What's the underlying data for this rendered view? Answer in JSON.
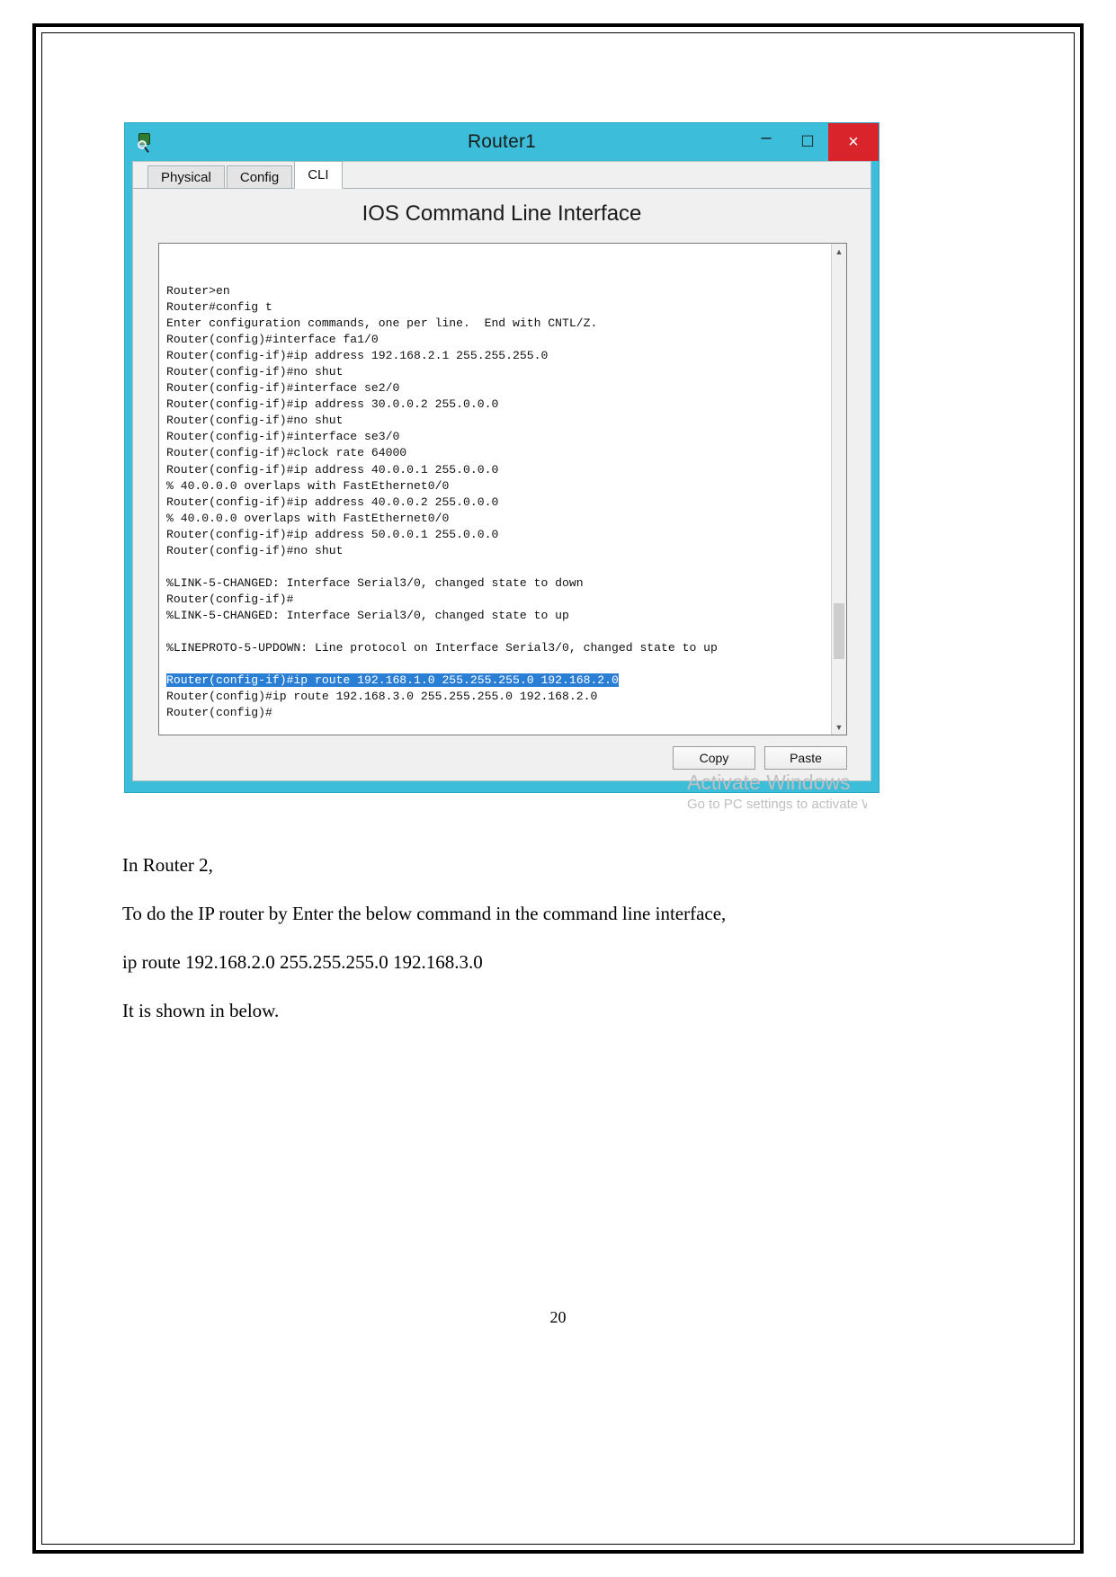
{
  "document": {
    "page_number": "20",
    "paragraphs": [
      "In Router 2,",
      "To do the IP router by Enter the below command in the command line interface,",
      "ip route 192.168.2.0 255.255.255.0 192.168.3.0",
      "It is shown in below."
    ]
  },
  "window": {
    "title": "Router1",
    "app_icon": "packet-tracer-router-icon",
    "buttons": {
      "minimize": "–",
      "maximize": "☐",
      "close": "×"
    },
    "tabs": [
      {
        "label": "Physical",
        "active": false
      },
      {
        "label": "Config",
        "active": false
      },
      {
        "label": "CLI",
        "active": true
      }
    ],
    "heading": "IOS Command Line Interface",
    "actions": {
      "copy": "Copy",
      "paste": "Paste"
    },
    "scrollbar": {
      "up_arrow": "▲",
      "down_arrow": "▼"
    }
  },
  "terminal": {
    "lines": [
      {
        "text": "Router>en",
        "selected": false
      },
      {
        "text": "Router#config t",
        "selected": false
      },
      {
        "text": "Enter configuration commands, one per line.  End with CNTL/Z.",
        "selected": false
      },
      {
        "text": "Router(config)#interface fa1/0",
        "selected": false
      },
      {
        "text": "Router(config-if)#ip address 192.168.2.1 255.255.255.0",
        "selected": false
      },
      {
        "text": "Router(config-if)#no shut",
        "selected": false
      },
      {
        "text": "Router(config-if)#interface se2/0",
        "selected": false
      },
      {
        "text": "Router(config-if)#ip address 30.0.0.2 255.0.0.0",
        "selected": false
      },
      {
        "text": "Router(config-if)#no shut",
        "selected": false
      },
      {
        "text": "Router(config-if)#interface se3/0",
        "selected": false
      },
      {
        "text": "Router(config-if)#clock rate 64000",
        "selected": false
      },
      {
        "text": "Router(config-if)#ip address 40.0.0.1 255.0.0.0",
        "selected": false
      },
      {
        "text": "% 40.0.0.0 overlaps with FastEthernet0/0",
        "selected": false
      },
      {
        "text": "Router(config-if)#ip address 40.0.0.2 255.0.0.0",
        "selected": false
      },
      {
        "text": "% 40.0.0.0 overlaps with FastEthernet0/0",
        "selected": false
      },
      {
        "text": "Router(config-if)#ip address 50.0.0.1 255.0.0.0",
        "selected": false
      },
      {
        "text": "Router(config-if)#no shut",
        "selected": false
      },
      {
        "text": "",
        "selected": false
      },
      {
        "text": "%LINK-5-CHANGED: Interface Serial3/0, changed state to down",
        "selected": false
      },
      {
        "text": "Router(config-if)#",
        "selected": false
      },
      {
        "text": "%LINK-5-CHANGED: Interface Serial3/0, changed state to up",
        "selected": false
      },
      {
        "text": "",
        "selected": false
      },
      {
        "text": "%LINEPROTO-5-UPDOWN: Line protocol on Interface Serial3/0, changed state to up",
        "selected": false
      },
      {
        "text": "",
        "selected": false
      },
      {
        "text": "Router(config-if)#ip route 192.168.1.0 255.255.255.0 192.168.2.0",
        "selected": true
      },
      {
        "text": "Router(config)#ip route 192.168.3.0 255.255.255.0 192.168.2.0",
        "selected": false
      },
      {
        "text": "Router(config)#",
        "selected": false
      }
    ]
  },
  "watermark": {
    "line1": "Activate Windows",
    "line2": "Go to PC settings to activate Windows."
  },
  "colors": {
    "title_bar": "#3cbedb",
    "close_button": "#d9242b",
    "selection": "#2a7fd4",
    "watermark": "#bfbfbf"
  }
}
